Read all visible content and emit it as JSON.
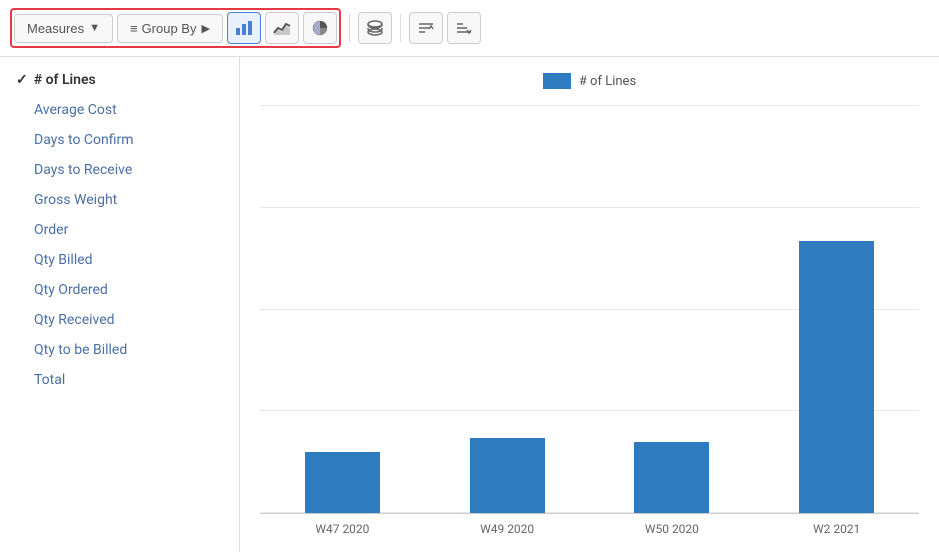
{
  "toolbar": {
    "measures_label": "Measures",
    "group_by_label": "Group By",
    "bar_chart_icon": "bar-chart",
    "line_chart_icon": "line-chart",
    "pie_chart_icon": "pie-chart",
    "stack_icon": "stack",
    "sort_asc_icon": "sort-asc",
    "sort_desc_icon": "sort-desc"
  },
  "sidebar": {
    "items": [
      {
        "id": "lines",
        "label": "# of Lines",
        "active": true,
        "checked": true
      },
      {
        "id": "avg-cost",
        "label": "Average Cost",
        "active": false,
        "checked": false
      },
      {
        "id": "days-confirm",
        "label": "Days to Confirm",
        "active": false,
        "checked": false
      },
      {
        "id": "days-receive",
        "label": "Days to Receive",
        "active": false,
        "checked": false
      },
      {
        "id": "gross-weight",
        "label": "Gross Weight",
        "active": false,
        "checked": false
      },
      {
        "id": "order",
        "label": "Order",
        "active": false,
        "checked": false
      },
      {
        "id": "qty-billed",
        "label": "Qty Billed",
        "active": false,
        "checked": false
      },
      {
        "id": "qty-ordered",
        "label": "Qty Ordered",
        "active": false,
        "checked": false
      },
      {
        "id": "qty-received",
        "label": "Qty Received",
        "active": false,
        "checked": false
      },
      {
        "id": "qty-to-billed",
        "label": "Qty to be Billed",
        "active": false,
        "checked": false
      },
      {
        "id": "total",
        "label": "Total",
        "active": false,
        "checked": false
      }
    ]
  },
  "chart": {
    "legend_label": "# of Lines",
    "legend_color": "#2f7bbf",
    "bars": [
      {
        "label": "W47 2020",
        "height_pct": 18
      },
      {
        "label": "W49 2020",
        "height_pct": 22
      },
      {
        "label": "W50 2020",
        "height_pct": 21
      },
      {
        "label": "W2 2021",
        "height_pct": 80
      }
    ]
  },
  "colors": {
    "highlight_border": "#e63946",
    "bar_color": "#2f7bbf",
    "active_btn_bg": "#e8f0fe"
  }
}
